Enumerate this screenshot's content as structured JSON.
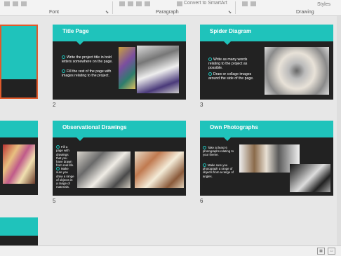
{
  "ribbon": {
    "groups": [
      "Font",
      "Paragraph",
      "Drawing"
    ],
    "convert_smartart": "Convert to SmartArt",
    "styles_label": "Styles"
  },
  "slides": [
    {
      "number": "",
      "title": ""
    },
    {
      "number": "2",
      "title": "Title Page",
      "bullets": [
        "Write the project title in bold letters somewhere on the page.",
        "Fill the rest of the page with images relating to the project."
      ]
    },
    {
      "number": "3",
      "title": "Spider Diagram",
      "bullets": [
        "Write as many words relating to the project as possible.",
        "Draw or collage images around the side of the page."
      ]
    },
    {
      "number": "",
      "title": ""
    },
    {
      "number": "5",
      "title": "Observational Drawings",
      "bullets": [
        "Fill a page with drawings that you have drawn from real life.",
        "Make sure you draw a range of objects in a range of materials."
      ]
    },
    {
      "number": "6",
      "title": "Own Photographs",
      "bullets": [
        "Take at least 6 photographs relating to your theme.",
        "Make sure you photograph a range of objects from a range of angles."
      ]
    },
    {
      "number": "",
      "title": ""
    }
  ],
  "colors": {
    "accent": "#1fc3bb",
    "slide_bg": "#222222",
    "selection": "#e05a2b"
  }
}
